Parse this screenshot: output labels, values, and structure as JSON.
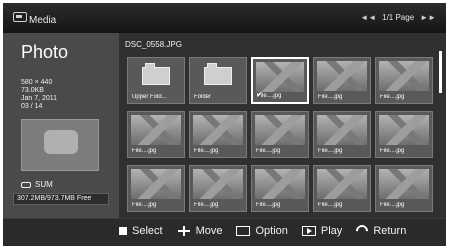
{
  "header": {
    "app_label": "Media",
    "page_info": "1/1 Page"
  },
  "left_panel": {
    "title": "Photo",
    "resolution": "580 × 440",
    "size": "73.0KB",
    "date": "Jan 7, 2011",
    "index": "03 / 14",
    "device": "SUM",
    "storage": "307.2MB/973.7MB Free"
  },
  "main": {
    "current_file": "DSC_0558.JPG",
    "tiles": [
      {
        "type": "folder",
        "label": "Upper Fold..."
      },
      {
        "type": "folder",
        "label": "Folder"
      },
      {
        "type": "photo",
        "label": "File....jpg",
        "selected": true,
        "checked": true
      },
      {
        "type": "photo",
        "label": "File....jpg"
      },
      {
        "type": "photo",
        "label": "File....jpg"
      },
      {
        "type": "photo",
        "label": "File....jpg"
      },
      {
        "type": "photo",
        "label": "File....jpg"
      },
      {
        "type": "photo",
        "label": "File....jpg"
      },
      {
        "type": "photo",
        "label": "File....jpg"
      },
      {
        "type": "photo",
        "label": "File....jpg"
      },
      {
        "type": "photo",
        "label": "File....jpg"
      },
      {
        "type": "photo",
        "label": "File....jpg"
      },
      {
        "type": "photo",
        "label": "File....jpg"
      },
      {
        "type": "photo",
        "label": "File....jpg"
      },
      {
        "type": "photo",
        "label": "File....jpg"
      }
    ]
  },
  "keyguide": [
    {
      "icon": "square-icon",
      "label": "Select"
    },
    {
      "icon": "move-icon",
      "label": "Move"
    },
    {
      "icon": "option-icon",
      "label": "Option"
    },
    {
      "icon": "play-icon",
      "label": "Play"
    },
    {
      "icon": "return-icon",
      "label": "Return"
    }
  ]
}
